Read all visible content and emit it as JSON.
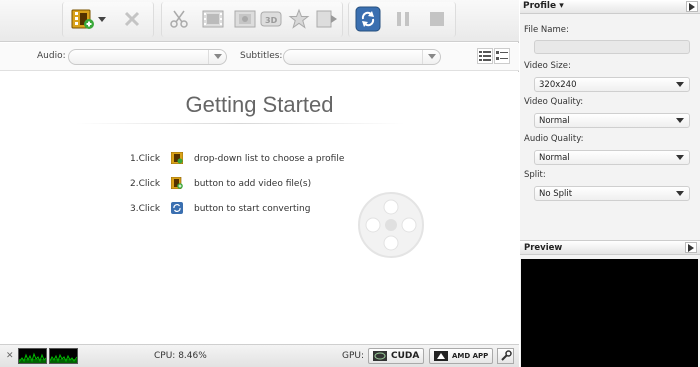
{
  "toolbar": {
    "buttons": [
      {
        "icon": "add-video-icon",
        "active": true
      },
      {
        "icon": "remove-icon",
        "active": false
      },
      {
        "icon": "clip-icon",
        "active": false
      },
      {
        "icon": "crop-icon",
        "active": false
      },
      {
        "icon": "3d-icon",
        "active": false
      },
      {
        "icon": "effect-icon",
        "active": false
      },
      {
        "icon": "merge-icon",
        "active": false
      },
      {
        "icon": "convert-icon",
        "active": true
      },
      {
        "icon": "pause-icon",
        "active": false
      },
      {
        "icon": "stop-icon",
        "active": false
      }
    ]
  },
  "options": {
    "audio_label": "Audio:",
    "audio_value": "",
    "subtitles_label": "Subtitles:",
    "subtitles_value": ""
  },
  "getting_started": {
    "title": "Getting Started",
    "steps": [
      {
        "num": "1.Click",
        "icon": "profile-icon",
        "text": "drop-down list to choose a profile"
      },
      {
        "num": "2.Click",
        "icon": "add-video-icon",
        "text": "button to add video file(s)"
      },
      {
        "num": "3.Click",
        "icon": "convert-icon",
        "text": "button to start converting"
      }
    ]
  },
  "status": {
    "cpu": "CPU: 8.46%",
    "gpu_label": "GPU:",
    "cuda": "CUDA",
    "amd": "AMD APP"
  },
  "profile": {
    "title": "Profile",
    "file_name_label": "File Name:",
    "file_name_value": "",
    "video_size_label": "Video Size:",
    "video_size_value": "320x240",
    "video_quality_label": "Video Quality:",
    "video_quality_value": "Normal",
    "audio_quality_label": "Audio Quality:",
    "audio_quality_value": "Normal",
    "split_label": "Split:",
    "split_value": "No Split"
  },
  "preview": {
    "title": "Preview"
  },
  "colors": {
    "accent_blue": "#3a6fb0",
    "preview_bg": "#000000",
    "graph_green": "#00c000"
  }
}
